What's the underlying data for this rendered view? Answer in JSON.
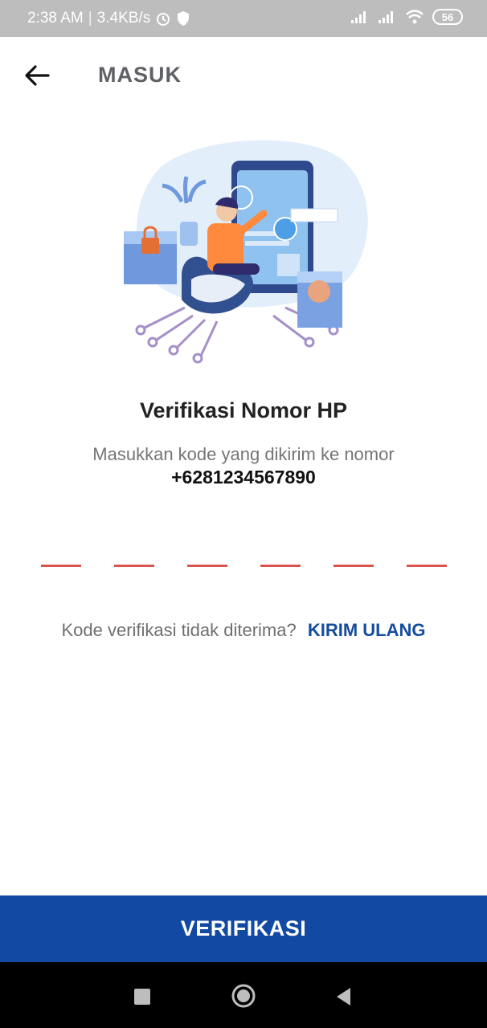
{
  "status_bar": {
    "time": "2:38 AM",
    "speed": "3.4KB/s",
    "battery": "56"
  },
  "app_bar": {
    "title": "MASUK"
  },
  "content": {
    "heading": "Verifikasi Nomor HP",
    "subtitle": "Masukkan kode yang dikirim ke nomor",
    "phone": "+6281234567890",
    "otp_digits": [
      "",
      "",
      "",
      "",
      "",
      ""
    ],
    "resend_prompt": "Kode verifikasi tidak diterima?",
    "resend_link": "KIRIM ULANG"
  },
  "verify_button": {
    "label": "VERIFIKASI"
  },
  "colors": {
    "primary": "#1149a3",
    "otp_underline": "#d9534f",
    "status_bar": "#bdbdbd"
  }
}
